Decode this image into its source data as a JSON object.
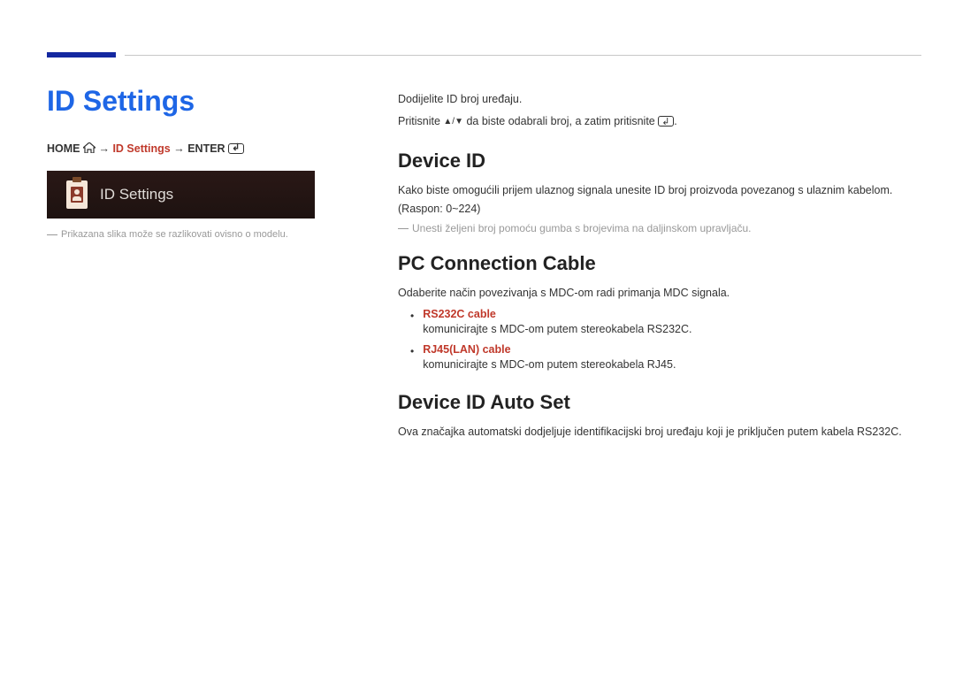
{
  "title": "ID Settings",
  "breadcrumb": {
    "home": "HOME",
    "mid": "ID Settings",
    "enter": "ENTER"
  },
  "screenshot_label": "ID Settings",
  "disclaimer": "Prikazana slika može se razlikovati ovisno o modelu.",
  "intro1": "Dodijelite ID broj uređaju.",
  "intro2_a": "Pritisnite ",
  "intro2_b": " da biste odabrali broj, a zatim pritisnite ",
  "intro2_c": ".",
  "device_id": {
    "heading": "Device ID",
    "text": "Kako biste omogućili prijem ulaznog signala unesite ID broj proizvoda povezanog s ulaznim kabelom. (Raspon: 0~224)",
    "note": "Unesti željeni broj pomoću gumba s brojevima na daljinskom upravljaču."
  },
  "pc_cable": {
    "heading": "PC Connection Cable",
    "text": "Odaberite način povezivanja s MDC-om radi primanja MDC signala.",
    "opt1_label": "RS232C cable",
    "opt1_text": "komunicirajte s MDC-om putem stereokabela RS232C.",
    "opt2_label": "RJ45(LAN) cable",
    "opt2_text": "komunicirajte s MDC-om putem stereokabela RJ45."
  },
  "auto_set": {
    "heading": "Device ID Auto Set",
    "text": "Ova značajka automatski dodjeljuje identifikacijski broj uređaju koji je priključen putem kabela RS232C."
  }
}
